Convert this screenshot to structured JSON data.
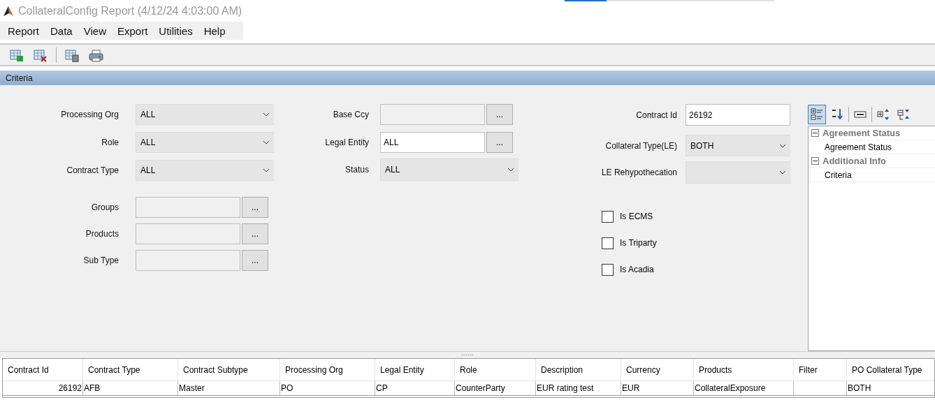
{
  "window": {
    "title": "CollateralConfig Report (4/12/24 4:03:00 AM)"
  },
  "progress": {
    "level": 0.2
  },
  "menu": [
    "Report",
    "Data",
    "View",
    "Export",
    "Utilities",
    "Help"
  ],
  "section_title": "Criteria",
  "form": {
    "left": [
      {
        "label": "Processing Org",
        "kind": "select",
        "value": "ALL"
      },
      {
        "label": "Role",
        "kind": "select",
        "value": "ALL"
      },
      {
        "label": "Contract Type",
        "kind": "select",
        "value": "ALL"
      },
      {
        "label": "Groups",
        "kind": "lookup",
        "button": "..."
      },
      {
        "label": "Products",
        "kind": "lookup",
        "button": "..."
      },
      {
        "label": "Sub Type",
        "kind": "lookup",
        "button": "..."
      }
    ],
    "middle": [
      {
        "label": "Base Ccy",
        "kind": "lookup",
        "button": "..."
      },
      {
        "label": "Legal Entity",
        "kind": "lookup",
        "value": "ALL",
        "button": "..."
      },
      {
        "label": "Status",
        "kind": "select",
        "value": "ALL"
      }
    ],
    "right": [
      {
        "label": "Contract Id",
        "kind": "text",
        "value": "26192"
      },
      {
        "label": "Collateral Type(LE)",
        "kind": "select",
        "value": "BOTH"
      },
      {
        "label": "LE Rehypothecation",
        "kind": "select"
      }
    ],
    "checkboxes": [
      {
        "label": "Is ECMS",
        "checked": false
      },
      {
        "label": "Is Triparty",
        "checked": false
      },
      {
        "label": "Is Acadia",
        "checked": false
      }
    ]
  },
  "property_grid": {
    "tools": [
      {
        "kind": "categorized",
        "selected": true
      },
      {
        "kind": "alphabetical",
        "selected": false
      },
      {
        "kind": "pages",
        "selected": false
      },
      {
        "kind": "expand",
        "selected": false
      },
      {
        "kind": "collapse",
        "selected": false
      }
    ],
    "categories": [
      {
        "name": "Agreement Status",
        "expanded": true,
        "items": [
          "Agreement Status"
        ]
      },
      {
        "name": "Additional Info",
        "expanded": true,
        "items": [
          "Criteria"
        ]
      }
    ]
  },
  "table": {
    "columns": [
      "Contract Id",
      "Contract Type",
      "Contract Subtype",
      "Processing Org",
      "Legal Entity",
      "Role",
      "Description",
      "Currency",
      "Products",
      "Filter",
      "PO Collateral Type"
    ],
    "rows": [
      [
        "26192",
        "AFB",
        "Master",
        "PO",
        "CP",
        "CounterParty",
        "EUR rating test",
        "EUR",
        "CollateralExposure",
        "",
        "BOTH"
      ]
    ]
  }
}
